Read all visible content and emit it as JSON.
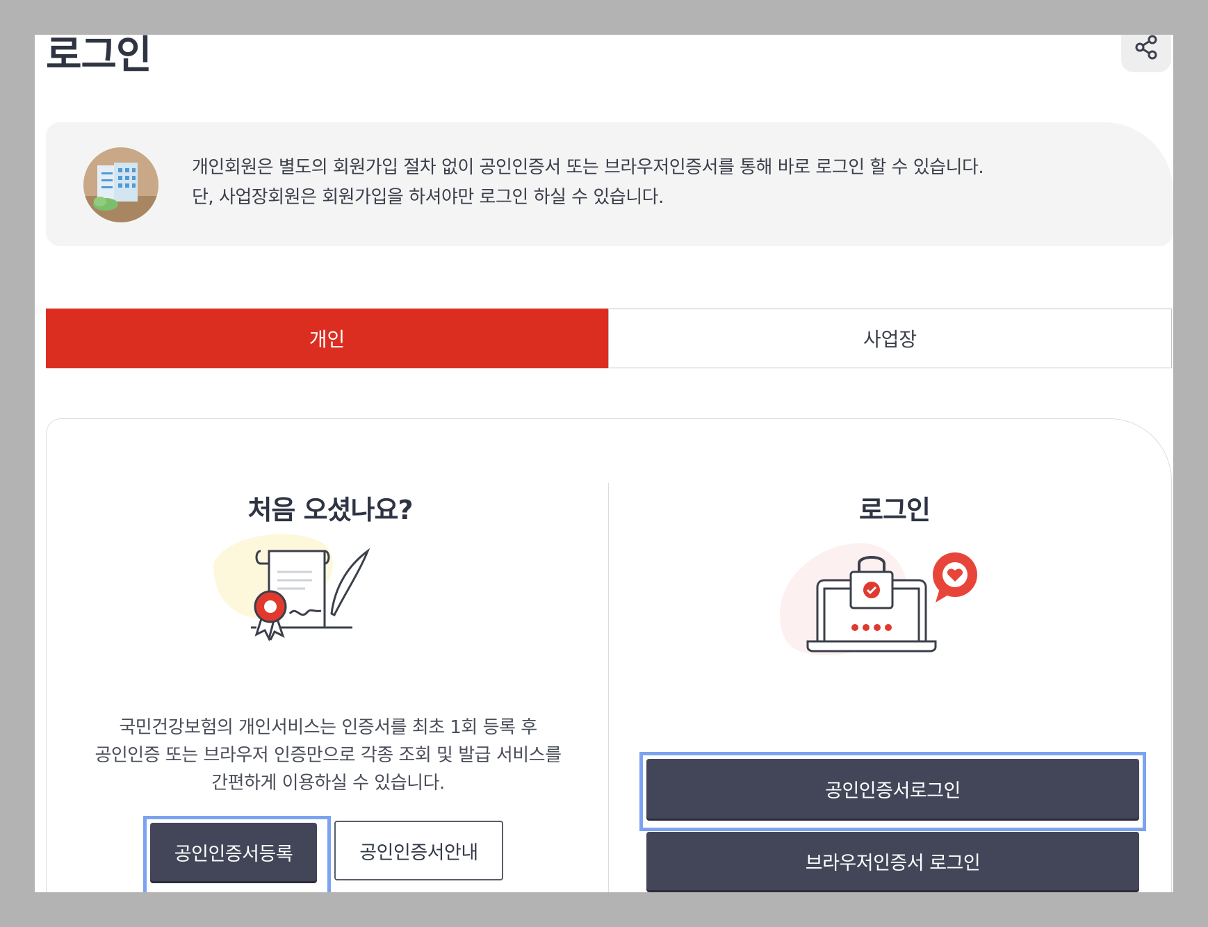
{
  "page": {
    "title": "로그인",
    "share_icon": "share-icon"
  },
  "notice": {
    "icon": "building-icon",
    "line1": "개인회원은 별도의 회원가입 절차 없이 공인인증서 또는 브라우저인증서를 통해 바로 로그인 할 수 있습니다.",
    "line2": "단, 사업장회원은 회원가입을 하셔야만 로그인 하실 수 있습니다."
  },
  "tabs": [
    {
      "label": "개인",
      "active": true
    },
    {
      "label": "사업장",
      "active": false
    }
  ],
  "left": {
    "title": "처음 오셨나요?",
    "illustration": "certificate-illustration",
    "desc_lines": [
      "국민건강보험의 개인서비스는 인증서를 최초 1회 등록 후",
      "공인인증 또는 브라우저 인증만으로 각종 조회 및 발급 서비스를",
      "간편하게 이용하실 수 있습니다."
    ],
    "register_button": "공인인증서등록",
    "guide_button": "공인인증서안내"
  },
  "right": {
    "title": "로그인",
    "illustration": "laptop-lock-illustration",
    "cert_login_button": "공인인증서로그인",
    "browser_login_button": "브라우저인증서 로그인"
  },
  "colors": {
    "accent": "#db2e21",
    "dark_button": "#434658",
    "highlight": "#7ca3f0",
    "overlay": "#b3b3b3"
  }
}
